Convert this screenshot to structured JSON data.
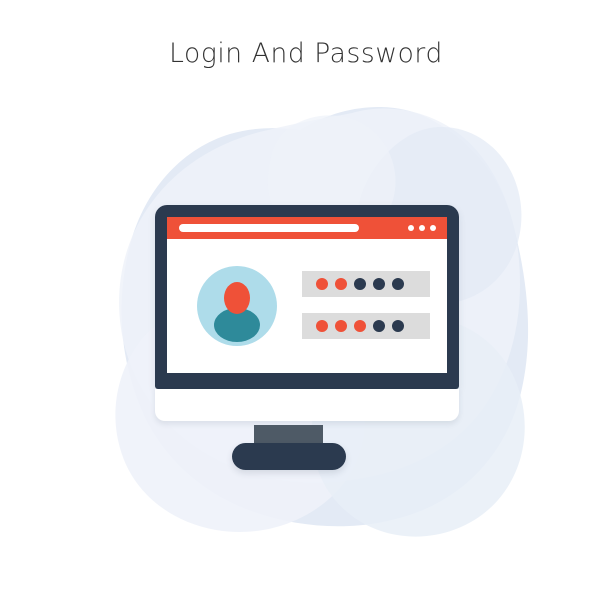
{
  "page": {
    "title": "Login And Password",
    "background_color": "#ffffff"
  },
  "palette": {
    "accent_red": "#ef5138",
    "dark_navy": "#2b3a4f",
    "stand_gray": "#4e5a66",
    "field_gray": "#dcdcdc",
    "avatar_circle_blue": "#aedcea",
    "avatar_body_teal": "#2e8a9a",
    "blob_light": "#eef2f9",
    "blob_mid": "#e3eaf5",
    "title_text": "#333333",
    "white": "#ffffff"
  },
  "illustration": {
    "name": "desktop-monitor-login-screen",
    "background_blobs": [
      {
        "name": "blob-back-cloud",
        "color": "#e3eaf5"
      },
      {
        "name": "blob-front-cloud",
        "color": "#eef2f9"
      }
    ],
    "monitor": {
      "bezel_color": "#2b3a4f",
      "chin_color": "#ffffff",
      "stand_neck_color": "#4e5a66",
      "stand_base_color": "#2b3a4f"
    },
    "browser": {
      "bar_color": "#ef5138",
      "address_bar_color": "#ffffff",
      "window_dots": [
        {
          "name": "window-dot-1",
          "color": "#ffffff"
        },
        {
          "name": "window-dot-2",
          "color": "#ffffff"
        },
        {
          "name": "window-dot-3",
          "color": "#ffffff"
        }
      ]
    },
    "avatar": {
      "name": "user-avatar",
      "circle_color": "#aedcea",
      "head_color": "#ef5138",
      "body_color": "#2e8a9a"
    },
    "form": {
      "fields": [
        {
          "name": "login-field",
          "background": "#dcdcdc",
          "dots": [
            "#ef5138",
            "#ef5138",
            "#2b3a4f",
            "#2b3a4f",
            "#2b3a4f"
          ]
        },
        {
          "name": "password-field",
          "background": "#dcdcdc",
          "dots": [
            "#ef5138",
            "#ef5138",
            "#ef5138",
            "#2b3a4f",
            "#2b3a4f"
          ]
        }
      ]
    }
  }
}
